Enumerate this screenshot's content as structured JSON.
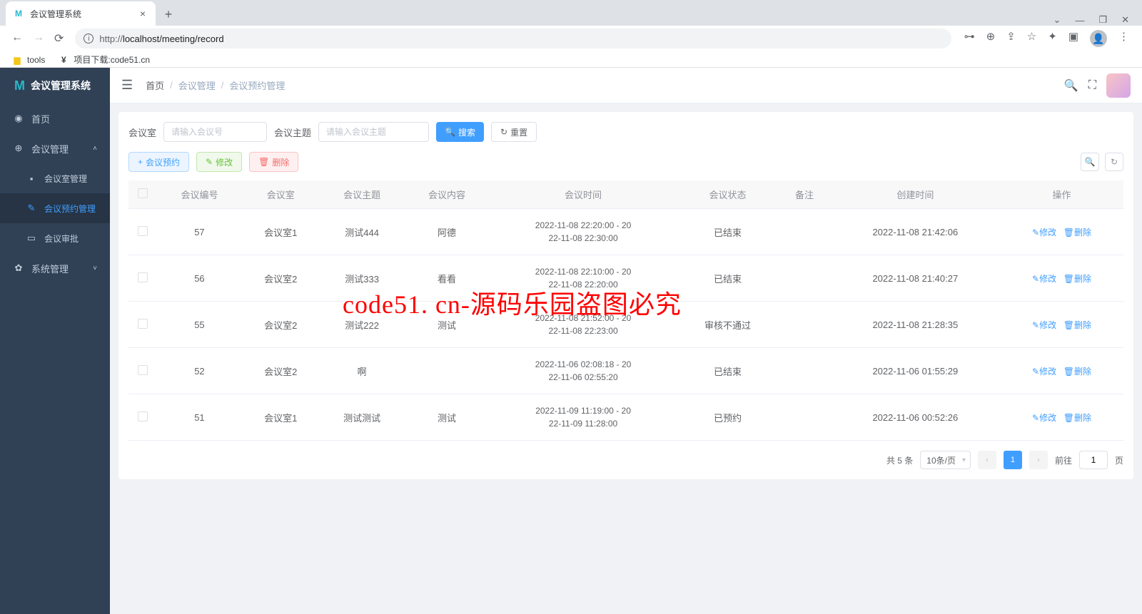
{
  "browser": {
    "tab_title": "会议管理系统",
    "url_host": "localhost",
    "url_path": "/meeting/record",
    "url_prefix": "http://",
    "bookmarks": [
      {
        "label": "tools",
        "icon": "📁",
        "color": "#f5c518"
      },
      {
        "label": "项目下载:code51.cn",
        "icon": "¥",
        "color": "#000"
      }
    ]
  },
  "app": {
    "title": "会议管理系统"
  },
  "sidebar": {
    "home": "首页",
    "meeting_mgmt": "会议管理",
    "room_mgmt": "会议室管理",
    "booking_mgmt": "会议预约管理",
    "approval": "会议审批",
    "system_mgmt": "系统管理"
  },
  "breadcrumb": {
    "home": "首页",
    "level1": "会议管理",
    "level2": "会议预约管理"
  },
  "search": {
    "room_label": "会议室",
    "room_placeholder": "请输入会议号",
    "topic_label": "会议主题",
    "topic_placeholder": "请输入会议主题",
    "search_btn": "搜索",
    "reset_btn": "重置"
  },
  "toolbar": {
    "add_btn": "会议预约",
    "edit_btn": "修改",
    "delete_btn": "删除"
  },
  "table": {
    "headers": {
      "id": "会议编号",
      "room": "会议室",
      "topic": "会议主题",
      "content": "会议内容",
      "time": "会议时间",
      "status": "会议状态",
      "remark": "备注",
      "created": "创建时间",
      "action": "操作"
    },
    "rows": [
      {
        "id": "57",
        "room": "会议室1",
        "topic": "测试444",
        "content": "阿德",
        "time": "2022-11-08 22:20:00 - 2022-11-08 22:30:00",
        "status": "已结束",
        "remark": "",
        "created": "2022-11-08 21:42:06"
      },
      {
        "id": "56",
        "room": "会议室2",
        "topic": "测试333",
        "content": "看看",
        "time": "2022-11-08 22:10:00 - 2022-11-08 22:20:00",
        "status": "已结束",
        "remark": "",
        "created": "2022-11-08 21:40:27"
      },
      {
        "id": "55",
        "room": "会议室2",
        "topic": "测试222",
        "content": "测试",
        "time": "2022-11-08 21:52:00 - 2022-11-08 22:23:00",
        "status": "审核不通过",
        "remark": "",
        "created": "2022-11-08 21:28:35"
      },
      {
        "id": "52",
        "room": "会议室2",
        "topic": "啊",
        "content": "",
        "time": "2022-11-06 02:08:18 - 2022-11-06 02:55:20",
        "status": "已结束",
        "remark": "",
        "created": "2022-11-06 01:55:29"
      },
      {
        "id": "51",
        "room": "会议室1",
        "topic": "测试测试",
        "content": "测试",
        "time": "2022-11-09 11:19:00 - 2022-11-09 11:28:00",
        "status": "已预约",
        "remark": "",
        "created": "2022-11-06 00:52:26"
      }
    ],
    "row_action_edit": "修改",
    "row_action_delete": "删除"
  },
  "pagination": {
    "total_text": "共 5 条",
    "per_page": "10条/页",
    "current": "1",
    "goto_prefix": "前往",
    "goto_value": "1",
    "goto_suffix": "页"
  },
  "watermark": "code51. cn-源码乐园盗图必究"
}
